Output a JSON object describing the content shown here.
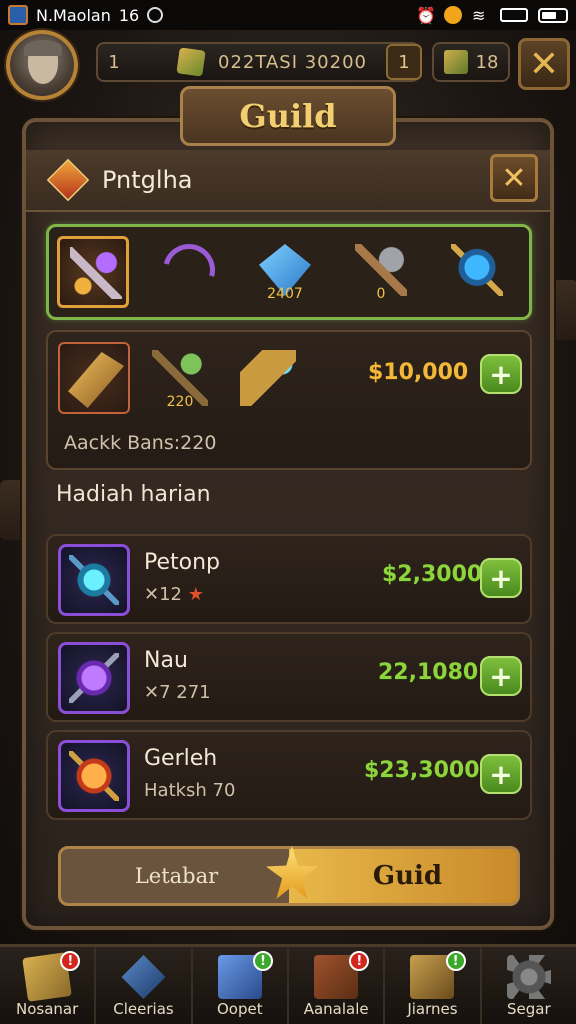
{
  "status_bar": {
    "carrier": "N.Maolan",
    "signal": "16"
  },
  "top_bar": {
    "level_left": "1",
    "currency_total": "022TASI 30200",
    "level_badge": "1",
    "secondary_currency": "18"
  },
  "panel": {
    "title": "Guild",
    "guild_name": "Pntglha",
    "items": [
      {
        "icon": "sword-icon",
        "label": ""
      },
      {
        "icon": "bow-icon",
        "label": ""
      },
      {
        "icon": "crystal-icon",
        "label": "2407"
      },
      {
        "icon": "hammer-icon",
        "label": "0"
      },
      {
        "icon": "gem-icon",
        "label": ""
      }
    ],
    "featured": {
      "slots": [
        {
          "icon": "drill-icon",
          "label": ""
        },
        {
          "icon": "staff-icon",
          "label": "220"
        },
        {
          "icon": "cannon-icon",
          "label": ""
        }
      ],
      "price": "$10,000",
      "subtitle": "Aackk Bans:220"
    },
    "section_title": "Hadiah harian",
    "rows": [
      {
        "name": "Petonp",
        "meta": "12",
        "price": "$2,3000",
        "icon": "orb-icon"
      },
      {
        "name": "Nau",
        "meta": "7   271",
        "price": "22,1080",
        "icon": "purple-gem-icon"
      },
      {
        "name": "Gerleh",
        "meta": "Hatksh 70",
        "price": "$23,3000",
        "icon": "fire-orb-icon"
      }
    ],
    "action_bar": {
      "left_label": "Letabar",
      "right_label": "Guid"
    }
  },
  "bottom_nav": [
    {
      "label": "Nosanar",
      "badge": "!",
      "badge_color": "#d2261e"
    },
    {
      "label": "Cleerias",
      "badge": "",
      "badge_color": ""
    },
    {
      "label": "Oopet",
      "badge": "!",
      "badge_color": "#3aa82a"
    },
    {
      "label": "Aanalale",
      "badge": "!",
      "badge_color": "#d2261e"
    },
    {
      "label": "Jiarnes",
      "badge": "!",
      "badge_color": "#3aa82a"
    },
    {
      "label": "Segar",
      "badge": "",
      "badge_color": ""
    }
  ]
}
